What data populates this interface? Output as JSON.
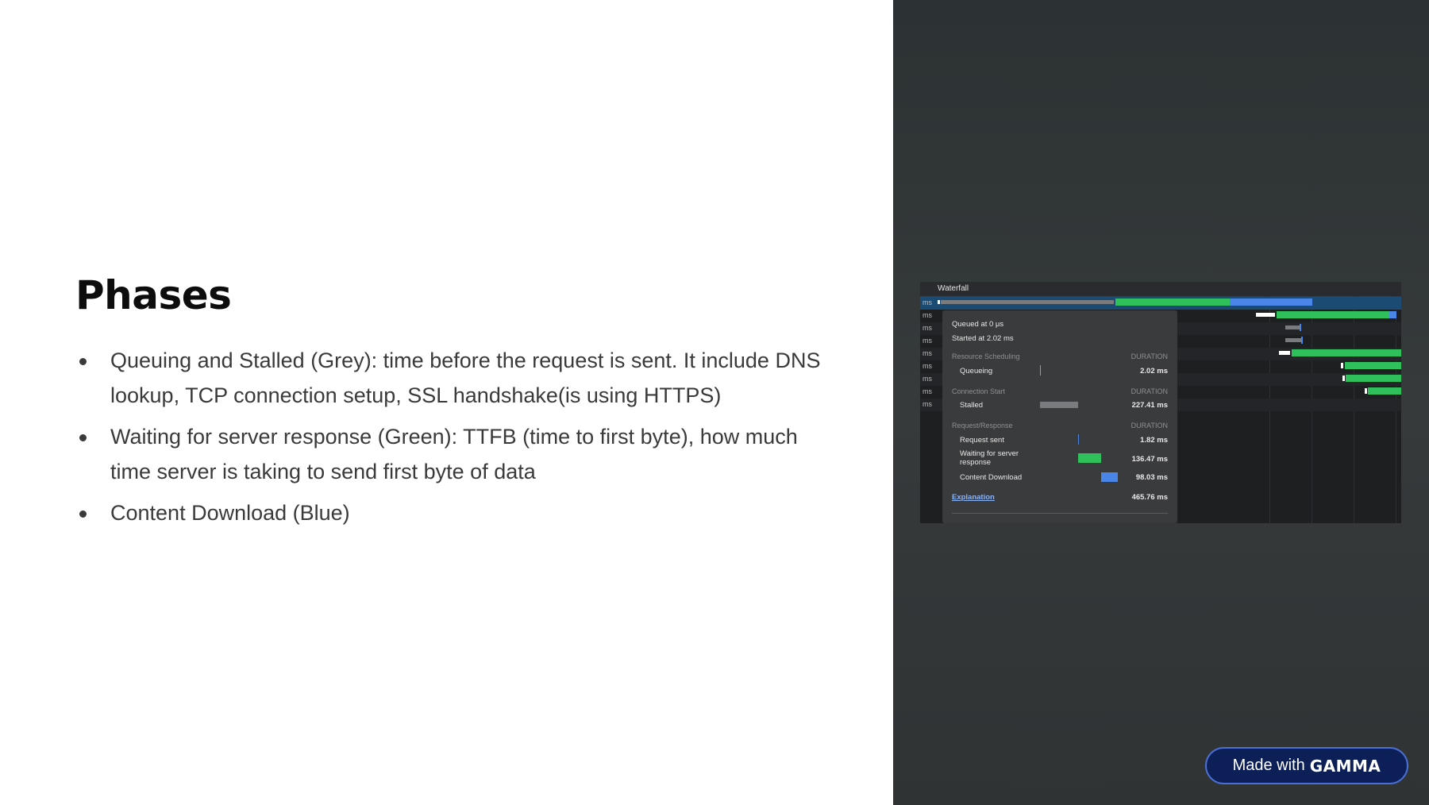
{
  "slide": {
    "title": "Phases",
    "bullets": [
      "Queuing and Stalled (Grey): time before the request is sent. It include DNS lookup, TCP connection setup, SSL handshake(is using HTTPS)",
      "Waiting for server response (Green): TTFB (time to first byte), how much time server is taking to send first byte of data",
      "Content Download (Blue)"
    ]
  },
  "devtools": {
    "header_label": "Waterfall",
    "row_unit": "ms",
    "tooltip": {
      "queued_at": "Queued at 0 μs",
      "started_at": "Started at 2.02 ms",
      "sections": [
        {
          "heading": "Resource Scheduling",
          "duration_label": "DURATION",
          "items": [
            {
              "label": "Queueing",
              "value": "2.02 ms"
            }
          ]
        },
        {
          "heading": "Connection Start",
          "duration_label": "DURATION",
          "items": [
            {
              "label": "Stalled",
              "value": "227.41 ms"
            }
          ]
        },
        {
          "heading": "Request/Response",
          "duration_label": "DURATION",
          "items": [
            {
              "label": "Request sent",
              "value": "1.82 ms"
            },
            {
              "label": "Waiting for server response",
              "value": "136.47 ms"
            },
            {
              "label": "Content Download",
              "value": "98.03 ms"
            }
          ]
        }
      ],
      "explanation_label": "Explanation",
      "total": "465.76 ms"
    },
    "colors": {
      "queue": "#7a7b7e",
      "waiting": "#2fbf5b",
      "download": "#4a86e8",
      "selected_row": "#1b4a73"
    }
  },
  "badge": {
    "prefix": "Made with",
    "brand": "GAMMA"
  }
}
